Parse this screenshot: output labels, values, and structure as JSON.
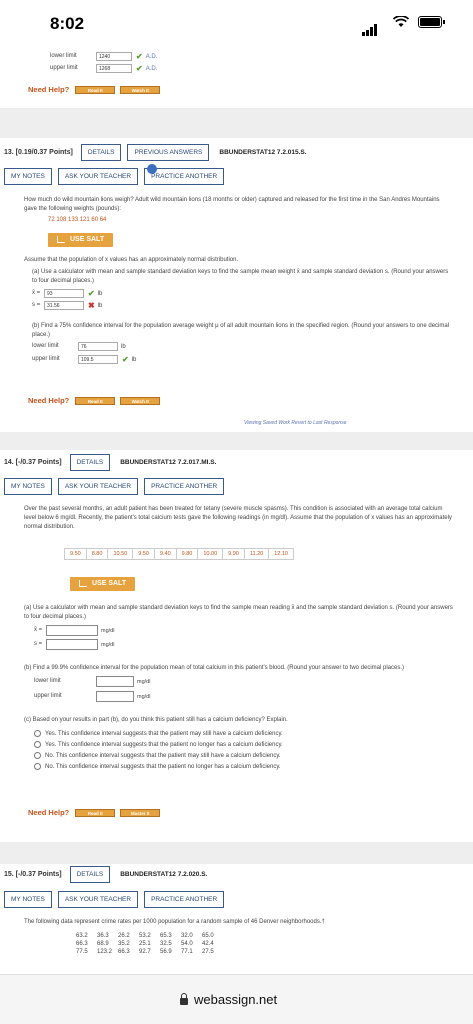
{
  "status": {
    "time": "8:02"
  },
  "q12": {
    "lower_label": "lower limit",
    "lower_val": "1240",
    "lower_ad": "A.D.",
    "upper_label": "upper limit",
    "upper_val": "1268",
    "upper_ad": "A.D.",
    "need_help": "Need Help?",
    "read": "Read It",
    "watch": "Watch It"
  },
  "q13": {
    "num": "13. [0.19/0.37 Points]",
    "details": "DETAILS",
    "prev": "PREVIOUS ANSWERS",
    "code": "BBUNDERSTAT12 7.2.015.S.",
    "notes": "MY NOTES",
    "ask": "ASK YOUR TEACHER",
    "practice": "PRACTICE ANOTHER",
    "question": "How much do wild mountain lions weigh? Adult wild mountain lions (18 months or older) captured and released for the first time in the San Andres Mountains gave the following weights (pounds):",
    "data": "72   108   133   121   60   64",
    "salt": "USE SALT",
    "assume": "Assume that the population of x values has an approximately normal distribution.",
    "part_a": "(a) Use a calculator with mean and sample standard deviation keys to find the sample mean weight x̄ and sample standard deviation s. (Round your answers to four decimal places.)",
    "xbar_label": "x̄ =",
    "xbar_val": "93",
    "xbar_unit": "lb",
    "s_label": "s =",
    "s_val": "31.56",
    "s_unit": "lb",
    "part_b": "(b) Find a 75% confidence interval for the population average weight μ of all adult mountain lions in the specified region. (Round your answers to one decimal place.)",
    "lower_label": "lower limit",
    "lower_val": "76",
    "lower_unit": "lb",
    "upper_label": "upper limit",
    "upper_val": "109.5",
    "upper_unit": "lb",
    "need_help": "Need Help?",
    "read": "Read It",
    "watch": "Watch It",
    "viewing": "Viewing Saved Work Revert to Last Response"
  },
  "q14": {
    "num": "14. [-/0.37 Points]",
    "details": "DETAILS",
    "code": "BBUNDERSTAT12 7.2.017.MI.S.",
    "notes": "MY NOTES",
    "ask": "ASK YOUR TEACHER",
    "practice": "PRACTICE ANOTHER",
    "question": "Over the past several months, an adult patient has been treated for tetany (severe muscle spasms). This condition is associated with an average total calcium level below 6 mg/dl. Recently, the patient's total calcium tests gave the following readings (in mg/dl). Assume that the population of x values has an approximately normal distribution.",
    "data": [
      "9.50",
      "8.80",
      "10.50",
      "9.50",
      "9.40",
      "9.80",
      "10.00",
      "9.90",
      "11.20",
      "12.10"
    ],
    "salt": "USE SALT",
    "part_a": "(a) Use a calculator with mean and sample standard deviation keys to find the sample mean reading x̄ and the sample standard deviation s. (Round your answers to four decimal places.)",
    "xbar_label": "x̄ =",
    "xbar_unit": "mg/dl",
    "s_label": "s =",
    "s_unit": "mg/dl",
    "part_b": "(b) Find a 99.9% confidence interval for the population mean of total calcium in this patient's blood. (Round your answer to two decimal places.)",
    "lower_label": "lower limit",
    "lower_unit": "mg/dl",
    "upper_label": "upper limit",
    "upper_unit": "mg/dl",
    "part_c": "(c) Based on your results in part (b), do you think this patient still has a calcium deficiency? Explain.",
    "options": [
      "Yes. This confidence interval suggests that the patient may still have a calcium deficiency.",
      "Yes. This confidence interval suggests that the patient no longer has a calcium deficiency.",
      "No. This confidence interval suggests that the patient may still have a calcium deficiency.",
      "No. This confidence interval suggests that the patient no longer has a calcium deficiency."
    ],
    "need_help": "Need Help?",
    "read": "Read It",
    "master": "Master It"
  },
  "q15": {
    "num": "15. [-/0.37 Points]",
    "details": "DETAILS",
    "code": "BBUNDERSTAT12 7.2.020.S.",
    "notes": "MY NOTES",
    "ask": "ASK YOUR TEACHER",
    "practice": "PRACTICE ANOTHER",
    "question": "The following data represent crime rates per 1000 population for a random sample of 46 Denver neighborhoods.†",
    "rows": [
      [
        "63.2",
        "36.3",
        "26.2",
        "53.2",
        "65.3",
        "32.0",
        "65.0"
      ],
      [
        "66.3",
        "68.9",
        "35.2",
        "25.1",
        "32.5",
        "54.0",
        "42.4"
      ],
      [
        "77.5",
        "123.2",
        "66.3",
        "92.7",
        "56.9",
        "77.1",
        "27.5"
      ]
    ]
  },
  "browser": {
    "url": "webassign.net"
  }
}
